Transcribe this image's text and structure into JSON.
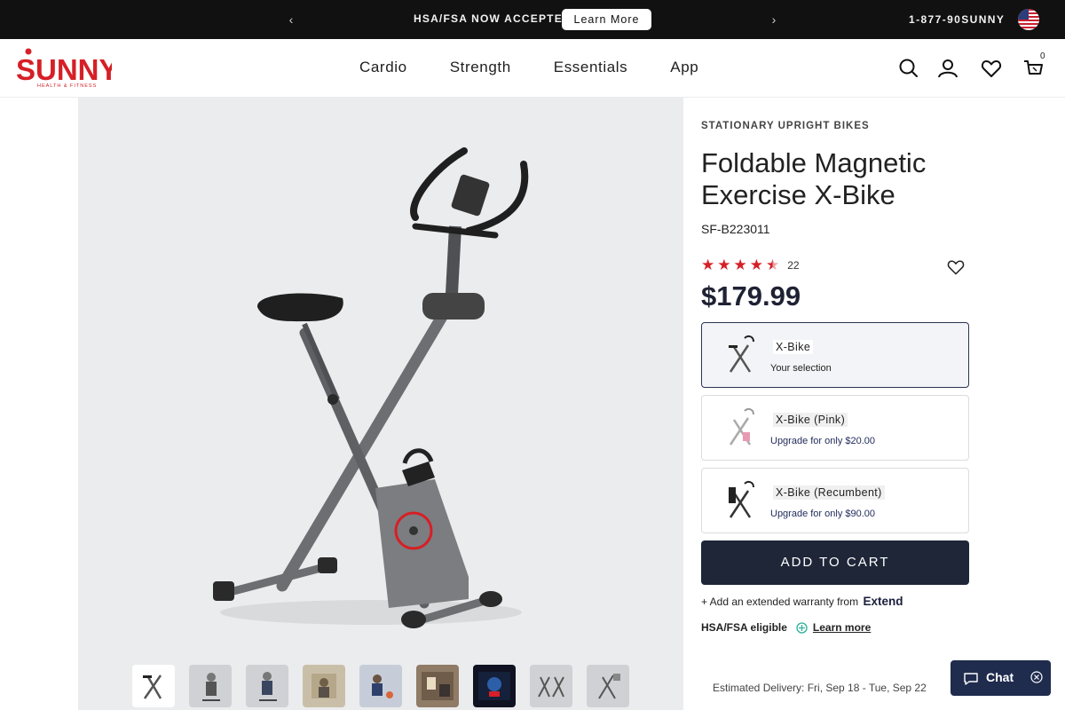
{
  "announcement": {
    "text": "HSA/FSA NOW ACCEPTED",
    "cta_label": "Learn More",
    "phone": "1-877-90SUNNY",
    "prev_icon": "chevron-left-icon",
    "next_icon": "chevron-right-icon"
  },
  "header": {
    "logo_text": "SUNNY",
    "logo_subtext": "HEALTH & FITNESS",
    "nav": [
      "Cardio",
      "Strength",
      "Essentials",
      "App"
    ],
    "cart_count": "0",
    "icons": [
      "search-icon",
      "account-icon",
      "wishlist-icon",
      "cart-icon"
    ]
  },
  "gallery": {
    "thumbnail_count": 9,
    "active_thumbnail": 1
  },
  "product": {
    "category": "STATIONARY UPRIGHT BIKES",
    "title": "Foldable Magnetic Exercise X-Bike",
    "sku": "SF-B223011",
    "rating": 4.5,
    "rating_count": "22",
    "price": "$179.99",
    "variants": [
      {
        "name": "X-Bike",
        "subtitle": "Your selection",
        "selected": true
      },
      {
        "name": "X-Bike (Pink)",
        "subtitle": "Upgrade for only $20.00",
        "selected": false
      },
      {
        "name": "X-Bike (Recumbent)",
        "subtitle": "Upgrade for only $90.00",
        "selected": false
      }
    ],
    "add_to_cart": "ADD TO CART",
    "warranty_text": "+ Add an extended warranty from",
    "warranty_brand": "Extend",
    "hsa_label": "HSA/FSA eligible",
    "hsa_link": "Learn more",
    "delivery": "Estimated Delivery: Fri, Sep 18 - Tue, Sep 22"
  },
  "chat": {
    "label": "Chat"
  },
  "colors": {
    "accent_red": "#d61f26",
    "navy": "#1e2638",
    "topbar": "#111111"
  }
}
